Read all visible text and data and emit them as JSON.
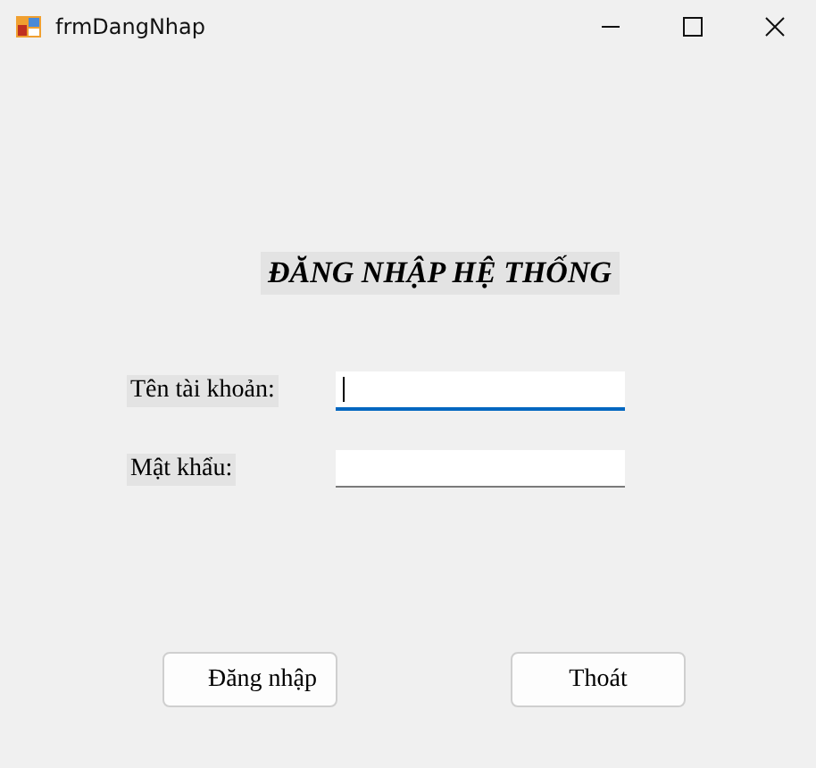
{
  "window": {
    "title": "frmDangNhap"
  },
  "heading": "ĐĂNG NHẬP HỆ THỐNG",
  "fields": [
    {
      "label": "Tên tài khoản:",
      "focused": true
    },
    {
      "label": "Mật khẩu:",
      "focused": false
    }
  ],
  "buttons": [
    "Đăng nhập",
    "Thoát"
  ]
}
